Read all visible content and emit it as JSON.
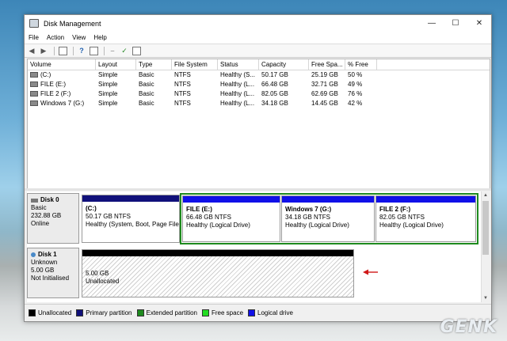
{
  "window": {
    "title": "Disk Management"
  },
  "menu": [
    "File",
    "Action",
    "View",
    "Help"
  ],
  "toolbar": {
    "icons": [
      "back-arrow-icon",
      "forward-arrow-icon",
      "console-tree-icon",
      "help-icon",
      "properties-icon",
      "rescan-icon",
      "check-icon",
      "list-view-icon"
    ]
  },
  "volumes": {
    "columns": [
      "Volume",
      "Layout",
      "Type",
      "File System",
      "Status",
      "Capacity",
      "Free Spa...",
      "% Free"
    ],
    "rows": [
      [
        "(C:)",
        "Simple",
        "Basic",
        "NTFS",
        "Healthy (S...",
        "50.17 GB",
        "25.19 GB",
        "50 %"
      ],
      [
        "FILE (E:)",
        "Simple",
        "Basic",
        "NTFS",
        "Healthy (L...",
        "66.48 GB",
        "32.71 GB",
        "49 %"
      ],
      [
        "FILE 2 (F:)",
        "Simple",
        "Basic",
        "NTFS",
        "Healthy (L...",
        "82.05 GB",
        "62.69 GB",
        "76 %"
      ],
      [
        "Windows 7 (G:)",
        "Simple",
        "Basic",
        "NTFS",
        "Healthy (L...",
        "34.18 GB",
        "14.45 GB",
        "42 %"
      ]
    ]
  },
  "disks": [
    {
      "name": "Disk 0",
      "type": "Basic",
      "size": "232.88 GB",
      "status": "Online",
      "partitions": [
        {
          "title": "(C:)",
          "size": "50.17 GB NTFS",
          "status": "Healthy (System, Boot, Page File",
          "bar_color": "#10107a"
        },
        {
          "title": "FILE  (E:)",
          "size": "66.48 GB NTFS",
          "status": "Healthy (Logical Drive)",
          "bar_color": "#1010e8"
        },
        {
          "title": "Windows 7  (G:)",
          "size": "34.18 GB NTFS",
          "status": "Healthy (Logical Drive)",
          "bar_color": "#1010e8"
        },
        {
          "title": "FILE 2  (F:)",
          "size": "82.05 GB NTFS",
          "status": "Healthy (Logical Drive)",
          "bar_color": "#1010e8"
        }
      ]
    },
    {
      "name": "Disk 1",
      "type": "Unknown",
      "size": "5.00 GB",
      "status": "Not Initialised",
      "partitions": [
        {
          "title": "",
          "size": "5.00 GB",
          "status": "Unallocated",
          "bar_color": "#000000"
        }
      ]
    }
  ],
  "legend": [
    {
      "label": "Unallocated",
      "color": "#000000"
    },
    {
      "label": "Primary partition",
      "color": "#10107a"
    },
    {
      "label": "Extended partition",
      "color": "#1e8a1e"
    },
    {
      "label": "Free space",
      "color": "#22dd22"
    },
    {
      "label": "Logical drive",
      "color": "#1010e8"
    }
  ],
  "watermark": "GENK"
}
